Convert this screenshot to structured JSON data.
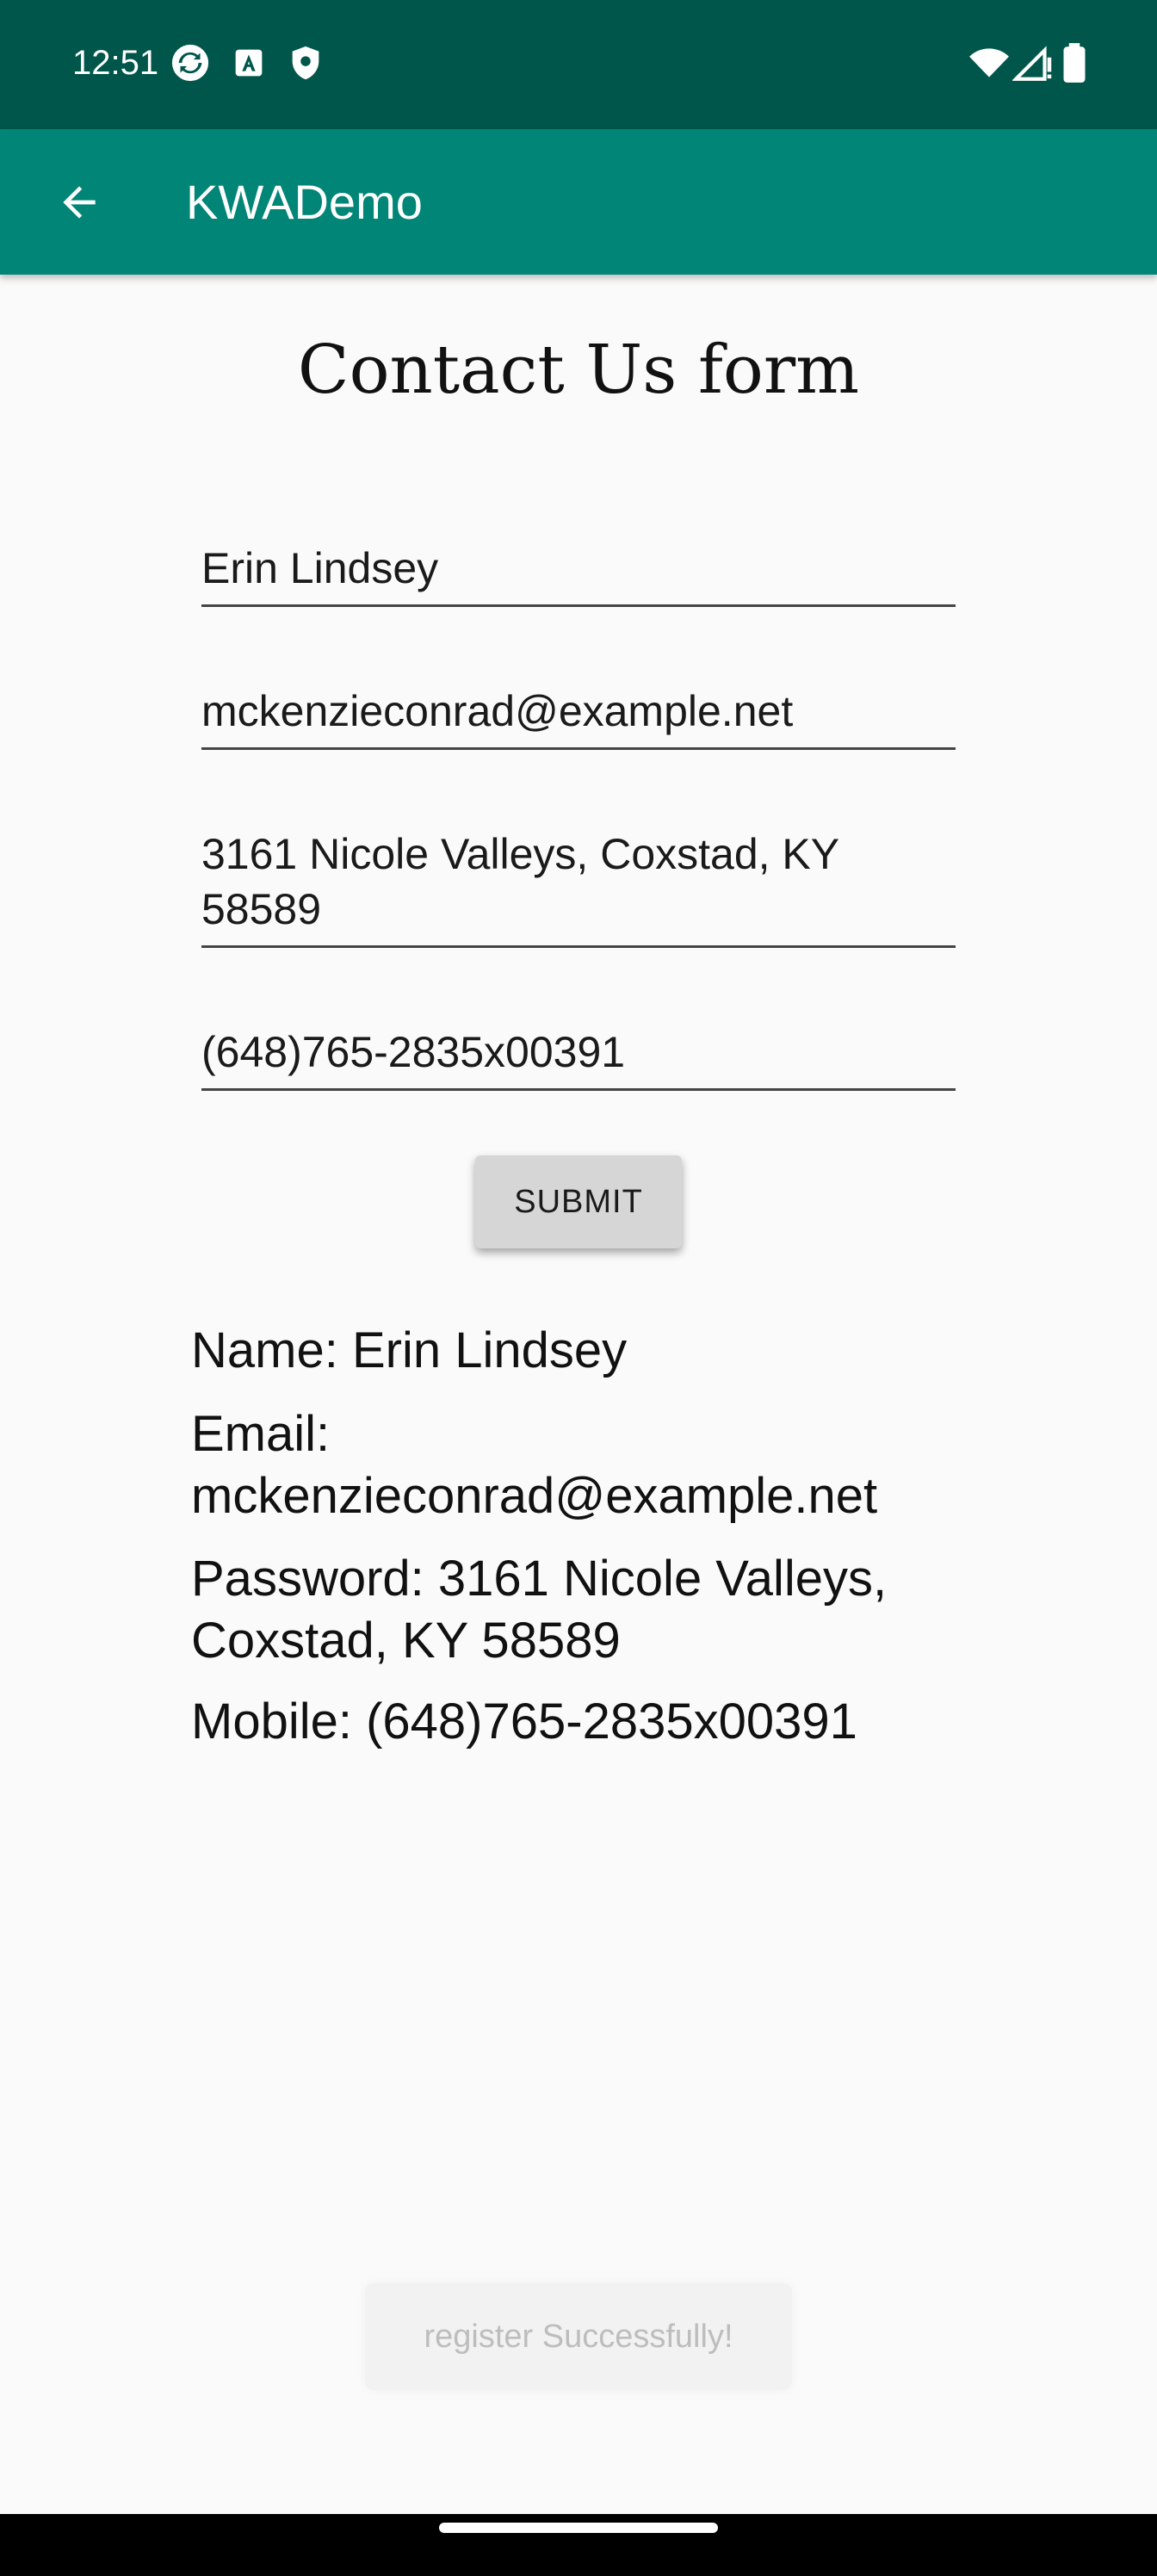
{
  "status_bar": {
    "time": "12:51"
  },
  "app_bar": {
    "title": "KWADemo"
  },
  "form": {
    "title": "Contact Us form",
    "name_value": "Erin Lindsey",
    "email_value": "mckenzieconrad@example.net",
    "address_line1": "3161 Nicole Valleys, Coxstad, KY",
    "address_line2": "58589",
    "mobile_value": "(648)765-2835x00391",
    "submit_label": "SUBMIT"
  },
  "results": {
    "name_line": "Name: Erin Lindsey",
    "email_line1": "Email:",
    "email_line2": "mckenzieconrad@example.net",
    "password_line1": "Password: 3161 Nicole Valleys,",
    "password_line2": "Coxstad, KY 58589",
    "mobile_line": "Mobile: (648)765-2835x00391"
  },
  "toast": {
    "message": "register Successfully!"
  },
  "colors": {
    "status_bar": "#00564a",
    "app_bar": "#008577",
    "background": "#fafafa"
  }
}
